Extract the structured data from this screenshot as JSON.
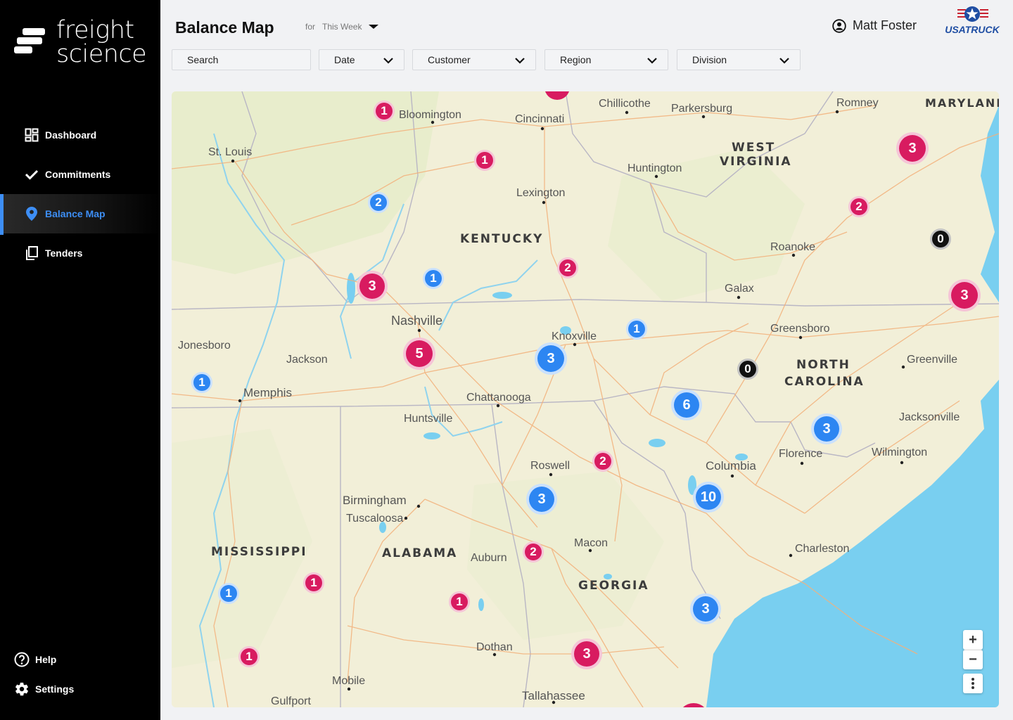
{
  "brand": {
    "app_name_line1": "freight",
    "app_name_line2": "science",
    "client_logo_text": "USATRUCK"
  },
  "nav": {
    "items": [
      {
        "label": "Dashboard",
        "icon": "dashboard-icon"
      },
      {
        "label": "Commitments",
        "icon": "check-icon"
      },
      {
        "label": "Balance Map",
        "icon": "location-pin-icon",
        "active": true
      },
      {
        "label": "Tenders",
        "icon": "documents-icon"
      }
    ],
    "bottom": [
      {
        "label": "Help",
        "icon": "help-icon"
      },
      {
        "label": "Settings",
        "icon": "gear-icon"
      }
    ]
  },
  "header": {
    "title": "Balance Map",
    "period_prefix": "for",
    "period_value": "This Week",
    "user_name": "Matt Foster"
  },
  "filters": {
    "search_placeholder": "Search",
    "date_label": "Date",
    "customer_label": "Customer",
    "region_label": "Region",
    "division_label": "Division"
  },
  "colors": {
    "accent": "#3d8ef5",
    "outbound": "#d81b60",
    "inbound": "#2d86f2",
    "neutral": "#111111",
    "water": "#79cff0"
  },
  "map": {
    "states": [
      "KENTUCKY",
      "WEST",
      "VIRGINIA",
      "MARYLAND",
      "NORTH",
      "CAROLINA",
      "MISSISSIPPI",
      "ALABAMA",
      "GEORGIA"
    ],
    "cities": [
      "Bloomington",
      "Cincinnati",
      "Chillicothe",
      "Parkersburg",
      "Romney",
      "St. Louis",
      "Huntington",
      "Lexington",
      "Roanoke",
      "Galax",
      "Greensboro",
      "Greenville",
      "Nashville",
      "Knoxville",
      "Jonesboro",
      "Jackson",
      "Memphis",
      "Chattanooga",
      "Huntsville",
      "Jacksonville",
      "Wilmington",
      "Florence",
      "Columbia",
      "Roswell",
      "Birmingham",
      "Tuscaloosa",
      "Macon",
      "Auburn",
      "Charleston",
      "Dothan",
      "Mobile",
      "Gulfport",
      "Tallahassee"
    ],
    "clusters": [
      {
        "count": "1",
        "type": "outbound"
      },
      {
        "count": "1",
        "type": "outbound"
      },
      {
        "count": "2",
        "type": "inbound"
      },
      {
        "count": "3",
        "type": "outbound"
      },
      {
        "count": "2",
        "type": "outbound"
      },
      {
        "count": "0",
        "type": "neutral"
      },
      {
        "count": "3",
        "type": "outbound"
      },
      {
        "count": "3",
        "type": "outbound"
      },
      {
        "count": "1",
        "type": "inbound"
      },
      {
        "count": "2",
        "type": "outbound"
      },
      {
        "count": "1",
        "type": "inbound"
      },
      {
        "count": "5",
        "type": "outbound"
      },
      {
        "count": "3",
        "type": "inbound"
      },
      {
        "count": "1",
        "type": "inbound"
      },
      {
        "count": "0",
        "type": "neutral"
      },
      {
        "count": "6",
        "type": "inbound"
      },
      {
        "count": "3",
        "type": "inbound"
      },
      {
        "count": "2",
        "type": "outbound"
      },
      {
        "count": "3",
        "type": "inbound"
      },
      {
        "count": "10",
        "type": "inbound"
      },
      {
        "count": "2",
        "type": "outbound"
      },
      {
        "count": "1",
        "type": "outbound"
      },
      {
        "count": "1",
        "type": "inbound"
      },
      {
        "count": "1",
        "type": "outbound"
      },
      {
        "count": "3",
        "type": "inbound"
      },
      {
        "count": "3",
        "type": "outbound"
      },
      {
        "count": "1",
        "type": "outbound"
      }
    ],
    "controls": {
      "zoom_in": "+",
      "zoom_out": "−"
    }
  }
}
